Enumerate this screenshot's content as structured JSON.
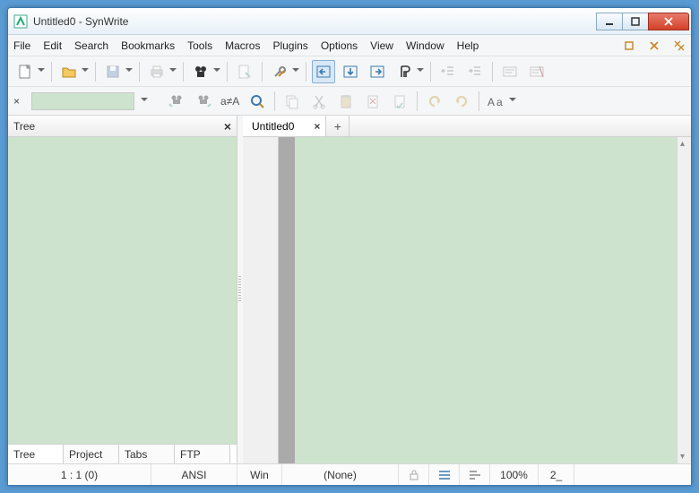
{
  "window": {
    "title": "Untitled0 - SynWrite"
  },
  "menu": {
    "items": [
      "File",
      "Edit",
      "Search",
      "Bookmarks",
      "Tools",
      "Macros",
      "Plugins",
      "Options",
      "View",
      "Window",
      "Help"
    ]
  },
  "sidebar": {
    "title": "Tree",
    "tabs": [
      "Tree",
      "Project",
      "Tabs",
      "FTP"
    ]
  },
  "editor": {
    "tabs": [
      {
        "label": "Untitled0"
      }
    ],
    "add": "+"
  },
  "status": {
    "pos": "1 : 1 (0)",
    "encoding": "ANSI",
    "line_ends": "Win",
    "lexer": "(None)",
    "zoom": "100%",
    "extras": "2_"
  },
  "icons": {
    "close_x": "×",
    "plus": "+"
  }
}
